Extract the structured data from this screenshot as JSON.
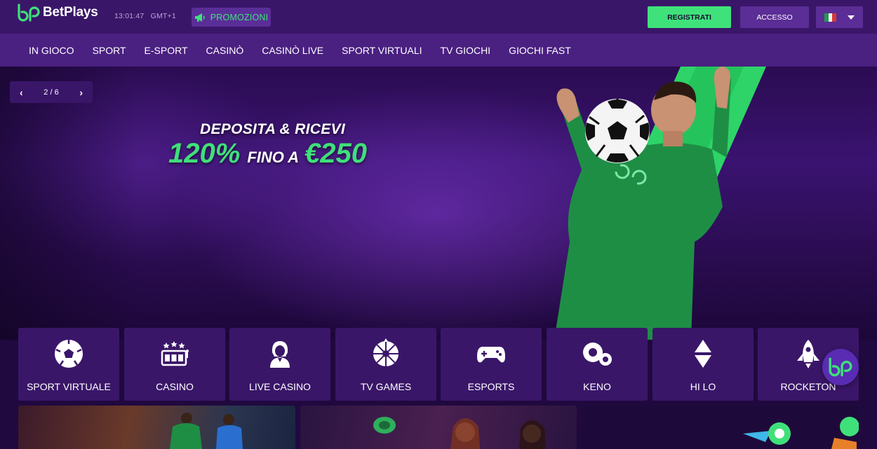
{
  "brand": {
    "name": "BetPlays",
    "accent": "#3fe07a",
    "primary": "#3a1669"
  },
  "header": {
    "time": "13:01:47",
    "timezone": "GMT+1",
    "promo_label": "PROMOZIONI",
    "register_label": "REGISTRATI",
    "login_label": "ACCESSO",
    "language_flag": "italy-flag-icon"
  },
  "nav": {
    "items": [
      {
        "label": "IN GIOCO"
      },
      {
        "label": "SPORT"
      },
      {
        "label": "E-SPORT"
      },
      {
        "label": "CASINÒ"
      },
      {
        "label": "CASINÒ LIVE"
      },
      {
        "label": "SPORT VIRTUALI"
      },
      {
        "label": "TV GIOCHI"
      },
      {
        "label": "GIOCHI FAST"
      }
    ]
  },
  "hero": {
    "slider_position": "2 / 6",
    "prev_icon": "chevron-left-icon",
    "next_icon": "chevron-right-icon",
    "line1": "DEPOSITA & RICEVI",
    "percent": "120%",
    "upto": "FINO A",
    "amount": "€250"
  },
  "categories": [
    {
      "label": "SPORT VIRTUALE",
      "icon": "soccer-ball-icon"
    },
    {
      "label": "CASINO",
      "icon": "slot-machine-icon"
    },
    {
      "label": "LIVE CASINO",
      "icon": "dealer-icon"
    },
    {
      "label": "TV GAMES",
      "icon": "roulette-wheel-icon"
    },
    {
      "label": "ESPORTS",
      "icon": "gamepad-icon"
    },
    {
      "label": "KENO",
      "icon": "keno-balls-icon"
    },
    {
      "label": "HI LO",
      "icon": "up-down-arrows-icon"
    },
    {
      "label": "ROCKETON",
      "icon": "rocket-icon"
    }
  ],
  "chat": {
    "icon": "betplays-chat-icon"
  }
}
